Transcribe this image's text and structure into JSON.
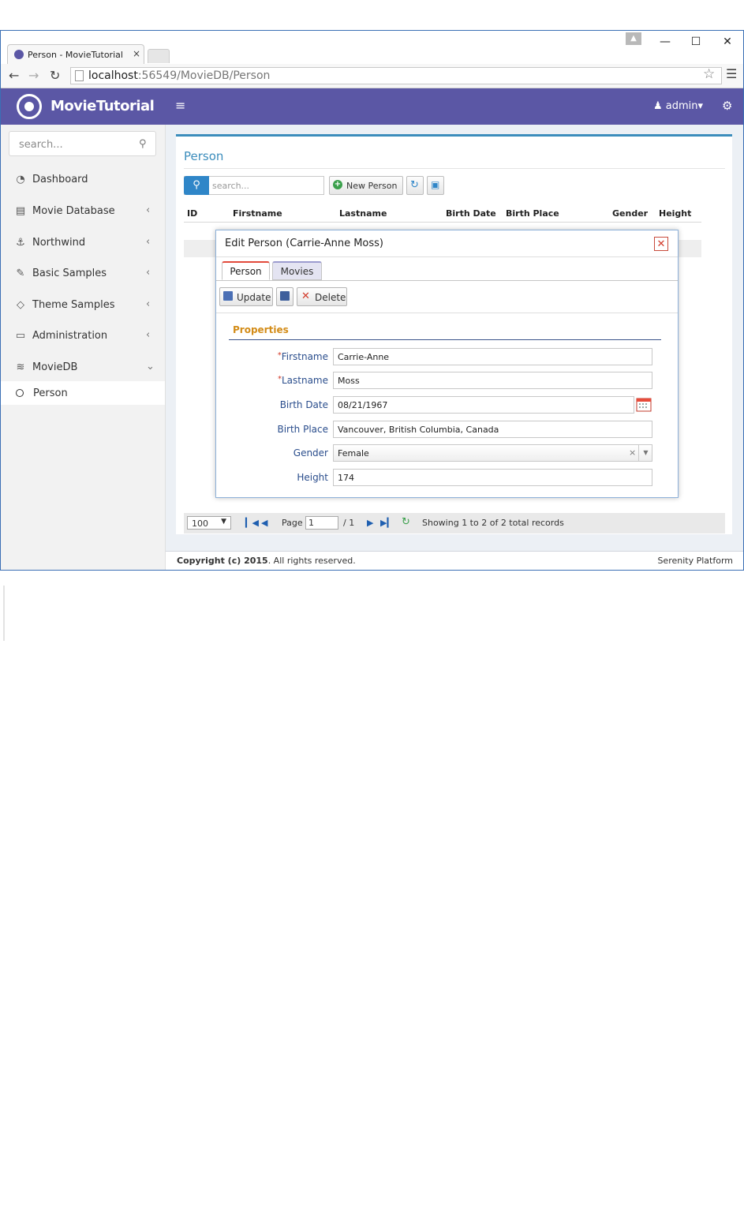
{
  "browser": {
    "tab_title": "Person - MovieTutorial",
    "tab_close": "×",
    "url_host": "localhost",
    "url_rest": ":56549/MovieDB/Person",
    "window_controls": {
      "minimize": "—",
      "maximize": "☐",
      "close": "✕"
    }
  },
  "header": {
    "logo_text": "MovieTutorial",
    "menu_toggle": "≡",
    "user_label": "admin",
    "settings_icon": "gear-icon"
  },
  "sidebar": {
    "search_placeholder": "search...",
    "items": [
      {
        "label": "Dashboard",
        "icon": "dashboard-icon",
        "glyph": "◔",
        "chevron": ""
      },
      {
        "label": "Movie Database",
        "icon": "film-icon",
        "glyph": "▤",
        "chevron": "‹"
      },
      {
        "label": "Northwind",
        "icon": "anchor-icon",
        "glyph": "⚓",
        "chevron": "‹"
      },
      {
        "label": "Basic Samples",
        "icon": "wrench-icon",
        "glyph": "✎",
        "chevron": "‹"
      },
      {
        "label": "Theme Samples",
        "icon": "diamond-icon",
        "glyph": "◇",
        "chevron": "‹"
      },
      {
        "label": "Administration",
        "icon": "monitor-icon",
        "glyph": "▭",
        "chevron": "‹"
      },
      {
        "label": "MovieDB",
        "icon": "layers-icon",
        "glyph": "≋",
        "chevron": "⌄"
      }
    ],
    "subitem": {
      "label": "Person"
    }
  },
  "grid": {
    "title": "Person",
    "search_placeholder": "search...",
    "new_button": "New Person",
    "columns": [
      "ID",
      "Firstname",
      "Lastname",
      "Birth Date",
      "Birth Place",
      "Gender",
      "Height"
    ]
  },
  "pager": {
    "page_size": "100",
    "page_label": "Page",
    "page_value": "1",
    "page_total": "/ 1",
    "info": "Showing 1 to 2 of 2 total records"
  },
  "footer": {
    "copyright_bold": "Copyright (c) 2015",
    "copyright_rest": ". All rights reserved.",
    "brand": "Serenity Platform"
  },
  "dialog": {
    "title": "Edit Person (Carrie-Anne Moss)",
    "tabs": [
      "Person",
      "Movies"
    ],
    "buttons": {
      "update": "Update",
      "delete": "Delete"
    },
    "category": "Properties",
    "fields": {
      "firstname": {
        "label": "Firstname",
        "value": "Carrie-Anne",
        "required": "*"
      },
      "lastname": {
        "label": "Lastname",
        "value": "Moss",
        "required": "*"
      },
      "birth_date": {
        "label": "Birth Date",
        "value": "08/21/1967"
      },
      "birth_place": {
        "label": "Birth Place",
        "value": "Vancouver, British Columbia, Canada"
      },
      "gender": {
        "label": "Gender",
        "value": "Female"
      },
      "height": {
        "label": "Height",
        "value": "174"
      }
    }
  },
  "colors": {
    "header_bg": "#5b57a5",
    "accent_blue": "#3c8dbc",
    "category_orange": "#d38c18",
    "required_red": "#d23a2a"
  }
}
